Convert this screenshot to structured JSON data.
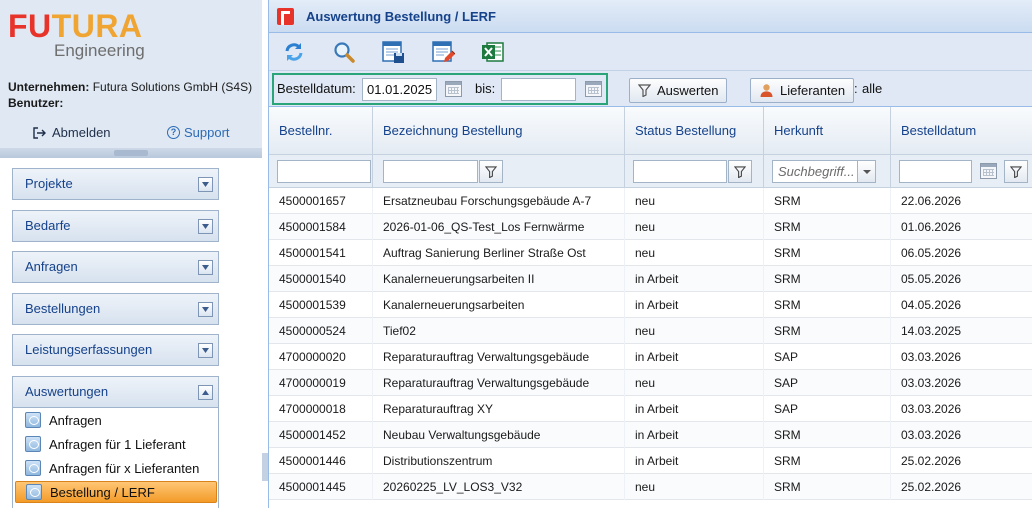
{
  "brand": {
    "logo_text": "FUTURA",
    "logo_sub": "Engineering"
  },
  "session": {
    "company_label": "Unternehmen:",
    "company_value": "Futura Solutions GmbH (S4S)",
    "user_label": "Benutzer:",
    "user_value": "",
    "logout_label": "Abmelden",
    "support_label": "Support"
  },
  "sidebar": {
    "sections": [
      {
        "label": "Projekte"
      },
      {
        "label": "Bedarfe"
      },
      {
        "label": "Anfragen"
      },
      {
        "label": "Bestellungen"
      },
      {
        "label": "Leistungserfassungen"
      },
      {
        "label": "Auswertungen"
      }
    ],
    "open_section_items": [
      {
        "label": "Anfragen"
      },
      {
        "label": "Anfragen für 1 Lieferant"
      },
      {
        "label": "Anfragen für x Lieferanten"
      },
      {
        "label": "Bestellung / LERF",
        "active": true
      }
    ]
  },
  "panel": {
    "title": "Auswertung Bestellung / LERF",
    "toolbar_icons": [
      "refresh-icon",
      "search-icon",
      "save-layout-icon",
      "edit-layout-icon",
      "excel-export-icon"
    ]
  },
  "filter": {
    "date_label": "Bestelldatum:",
    "date_from": "01.01.2025",
    "to_label": "bis:",
    "date_to": "",
    "evaluate_label": "Auswerten",
    "suppliers_label": "Lieferanten",
    "suppliers_value": "alle"
  },
  "grid": {
    "columns": [
      "Bestellnr.",
      "Bezeichnung Bestellung",
      "Status Bestellung",
      "Herkunft",
      "Bestelldatum"
    ],
    "origin_filter_placeholder": "Suchbegriff...",
    "rows": [
      [
        "4500001657",
        "Ersatzneubau Forschungsgebäude A-7",
        "neu",
        "SRM",
        "22.06.2026"
      ],
      [
        "4500001584",
        "2026-01-06_QS-Test_Los Fernwärme",
        "neu",
        "SRM",
        "01.06.2026"
      ],
      [
        "4500001541",
        "Auftrag Sanierung Berliner Straße Ost",
        "neu",
        "SRM",
        "06.05.2026"
      ],
      [
        "4500001540",
        "Kanalerneuerungsarbeiten II",
        "in Arbeit",
        "SRM",
        "05.05.2026"
      ],
      [
        "4500001539",
        "Kanalerneuerungsarbeiten",
        "in Arbeit",
        "SRM",
        "04.05.2026"
      ],
      [
        "4500000524",
        "Tief02",
        "neu",
        "SRM",
        "14.03.2025"
      ],
      [
        "4700000020",
        "Reparaturauftrag Verwaltungsgebäude",
        "in Arbeit",
        "SAP",
        "03.03.2026"
      ],
      [
        "4700000019",
        "Reparaturauftrag Verwaltungsgebäude",
        "neu",
        "SAP",
        "03.03.2026"
      ],
      [
        "4700000018",
        "Reparaturauftrag XY",
        "in Arbeit",
        "SAP",
        "03.03.2026"
      ],
      [
        "4500001452",
        "Neubau Verwaltungsgebäude",
        "in Arbeit",
        "SRM",
        "03.03.2026"
      ],
      [
        "4500001446",
        "Distributionszentrum",
        "in Arbeit",
        "SRM",
        "25.02.2026"
      ],
      [
        "4500001445",
        "20260225_LV_LOS3_V32",
        "neu",
        "SRM",
        "25.02.2026"
      ]
    ]
  },
  "colors": {
    "accent": "#15428b",
    "active_item": "#f39b28",
    "highlight_border": "#2aa57a",
    "logo_red": "#e8332a",
    "logo_orange": "#f0a431"
  }
}
